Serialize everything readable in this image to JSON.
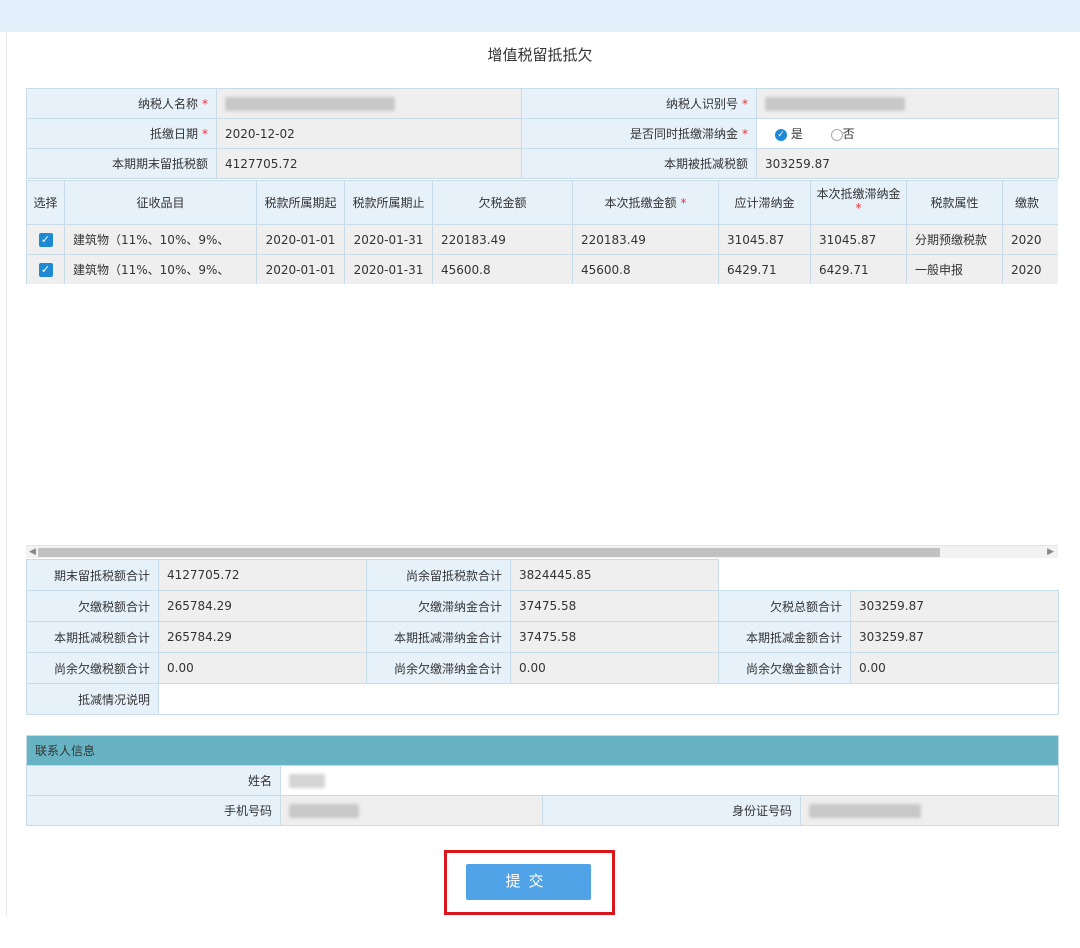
{
  "page": {
    "title": "增值税留抵抵欠"
  },
  "taxpayer": {
    "name_label": "纳税人名称",
    "id_label": "纳税人识别号",
    "date_label": "抵缴日期",
    "date_value": "2020-12-02",
    "late_fee_label": "是否同时抵缴滞纳金",
    "late_fee_yes": "是",
    "late_fee_no": "否",
    "end_credit_label": "本期期末留抵税额",
    "end_credit_value": "4127705.72",
    "deducted_label": "本期被抵减税额",
    "deducted_value": "303259.87",
    "required_mark": "*"
  },
  "grid": {
    "headers": [
      "选择",
      "征收品目",
      "税款所属期起",
      "税款所属期止",
      "欠税金额",
      "本次抵缴金额",
      "应计滞纳金",
      "本次抵缴滞纳金",
      "税款属性",
      "缴款"
    ],
    "rows": [
      {
        "item": "建筑物（11%、10%、9%、",
        "start": "2020-01-01",
        "end": "2020-01-31",
        "owed": "220183.49",
        "pay": "220183.49",
        "late_fee": "31045.87",
        "late_pay": "31045.87",
        "attr": "分期预缴税款",
        "payd": "2020"
      },
      {
        "item": "建筑物（11%、10%、9%、",
        "start": "2020-01-01",
        "end": "2020-01-31",
        "owed": "45600.8",
        "pay": "45600.8",
        "late_fee": "6429.71",
        "late_pay": "6429.71",
        "attr": "一般申报",
        "payd": "2020"
      }
    ]
  },
  "summary": {
    "end_credit_total_label": "期末留抵税额合计",
    "end_credit_total": "4127705.72",
    "remain_credit_label": "尚余留抵税款合计",
    "remain_credit": "3824445.85",
    "owed_tax_label": "欠缴税额合计",
    "owed_tax": "265784.29",
    "owed_fee_label": "欠缴滞纳金合计",
    "owed_fee": "37475.58",
    "owed_total_label": "欠税总额合计",
    "owed_total": "303259.87",
    "ded_tax_label": "本期抵减税额合计",
    "ded_tax": "265784.29",
    "ded_fee_label": "本期抵减滞纳金合计",
    "ded_fee": "37475.58",
    "ded_total_label": "本期抵减金额合计",
    "ded_total": "303259.87",
    "rem_tax_label": "尚余欠缴税额合计",
    "rem_tax": "0.00",
    "rem_fee_label": "尚余欠缴滞纳金合计",
    "rem_fee": "0.00",
    "rem_total_label": "尚余欠缴金额合计",
    "rem_total": "0.00",
    "note_label": "抵减情况说明"
  },
  "contact": {
    "header": "联系人信息",
    "name_label": "姓名",
    "phone_label": "手机号码",
    "idcard_label": "身份证号码"
  },
  "actions": {
    "submit": "提交"
  },
  "colors": {
    "accent": "#1e8ad6",
    "section": "#67b3c3",
    "highlight": "#d9161c"
  }
}
